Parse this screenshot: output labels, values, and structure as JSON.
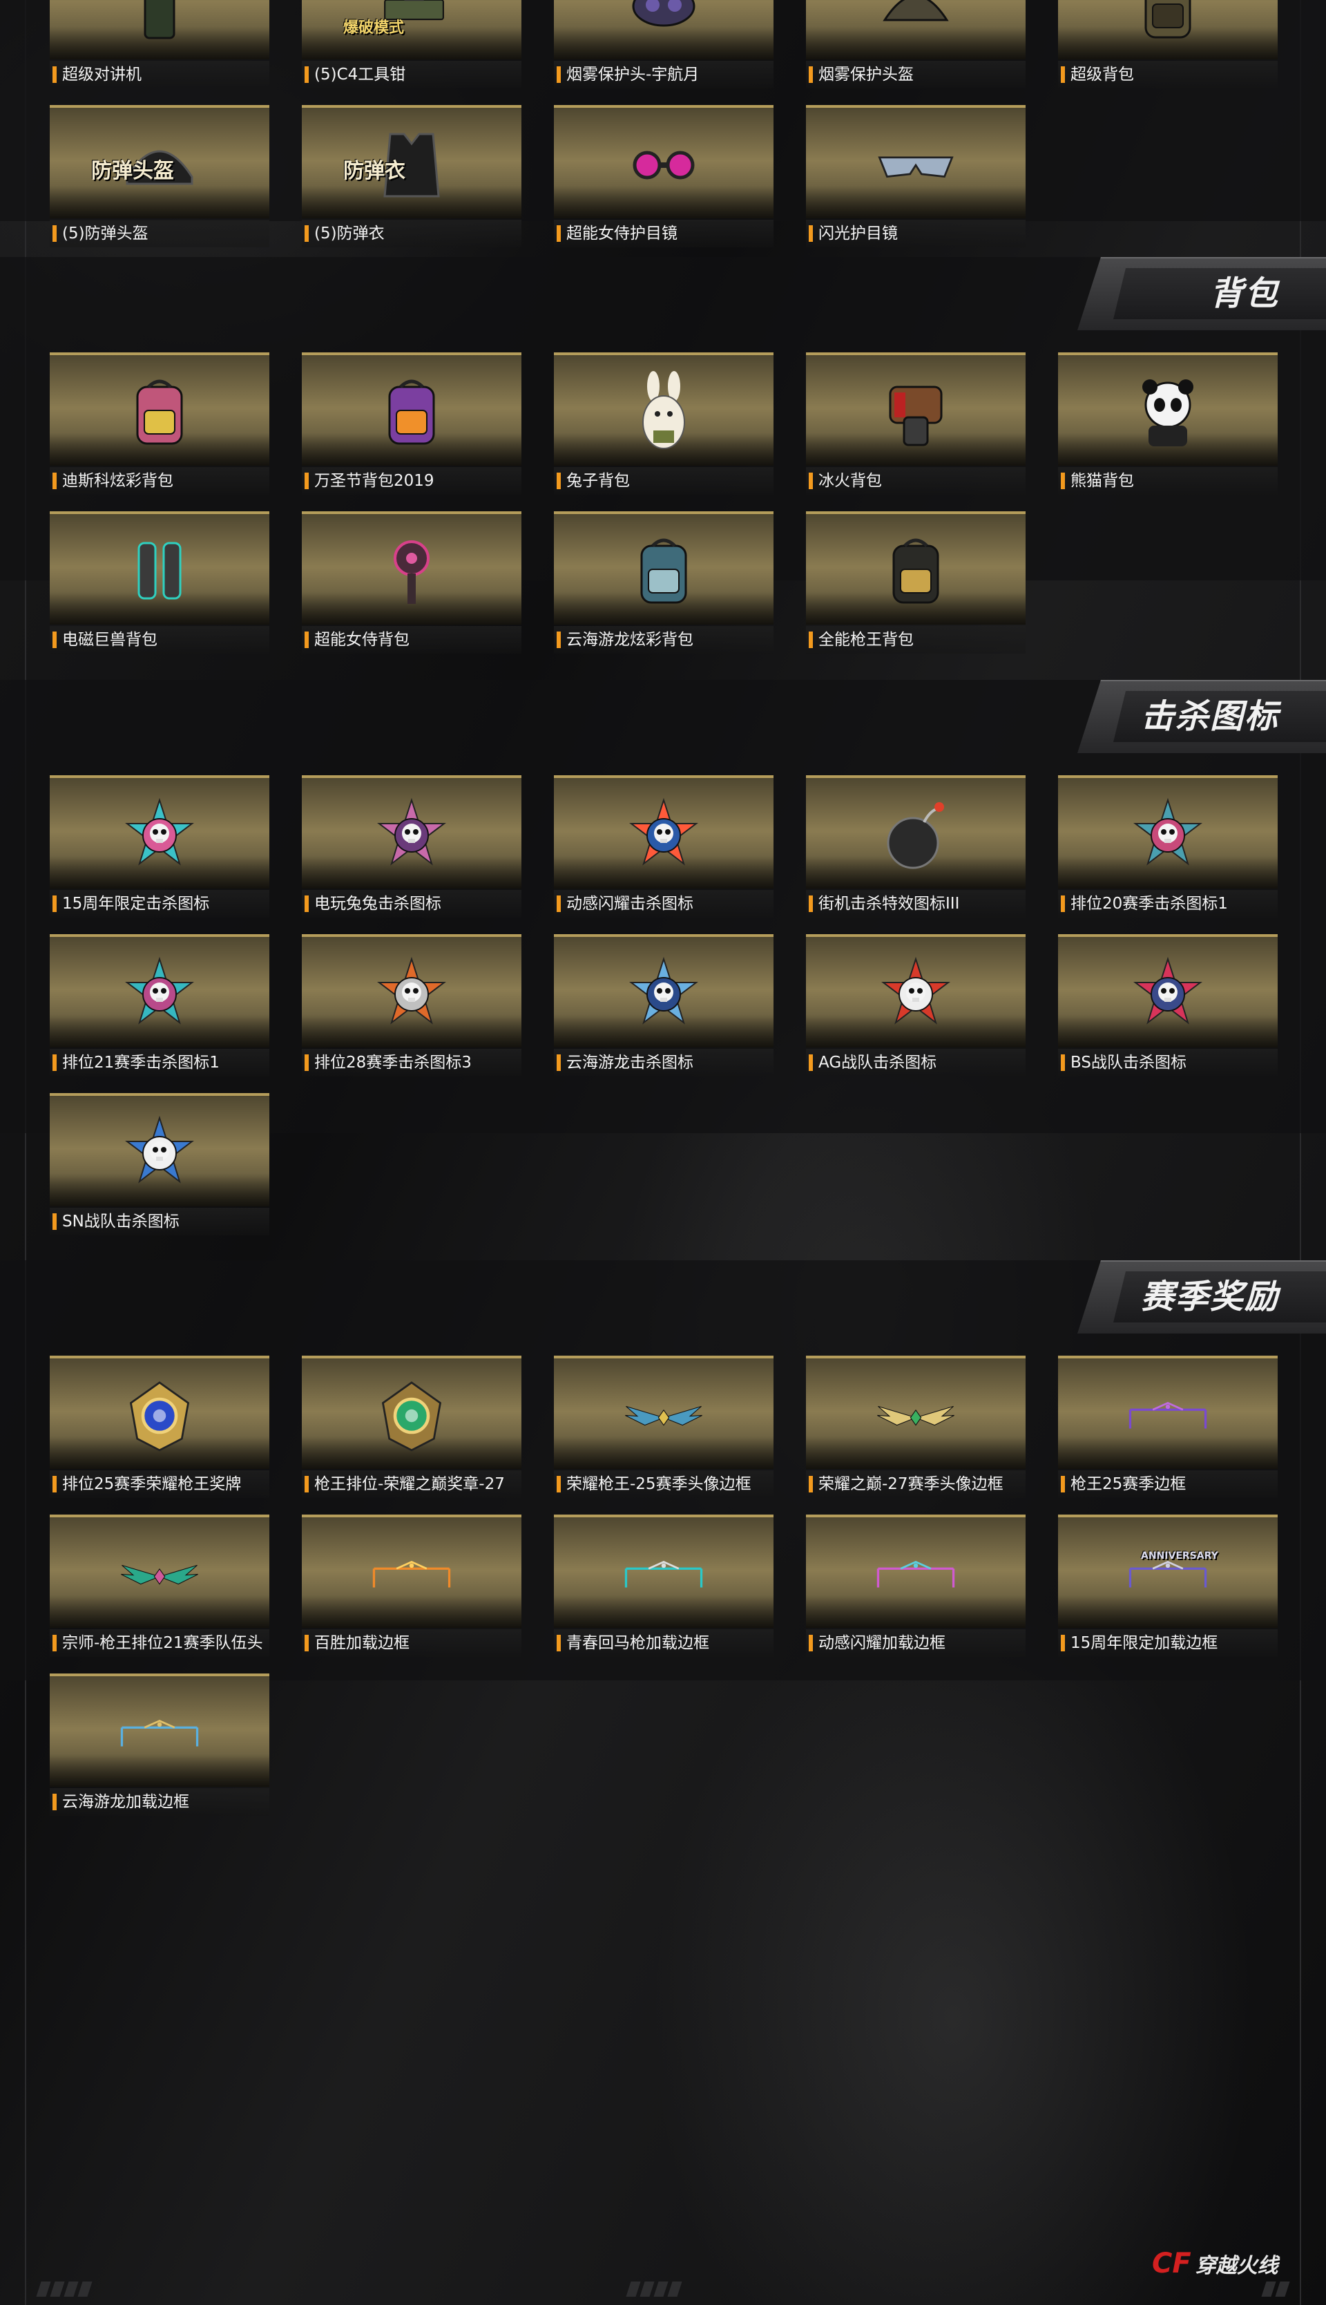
{
  "sections": [
    {
      "id": "top",
      "title": "",
      "items": [
        {
          "label": "超级对讲机",
          "icon": "walkie-talkie-icon"
        },
        {
          "label": "(5)C4工具钳",
          "icon": "toolbox-icon",
          "image_text": "爆破模式"
        },
        {
          "label": "烟雾保护头-宇航月",
          "icon": "smoke-mask-icon"
        },
        {
          "label": "烟雾保护头盔",
          "icon": "smoke-helmet-icon"
        },
        {
          "label": "超级背包",
          "icon": "backpack-icon"
        },
        {
          "label": "(5)防弹头盔",
          "icon": "helmet-icon",
          "image_text": "防弹头盔"
        },
        {
          "label": "(5)防弹衣",
          "icon": "vest-icon",
          "image_text": "防弹衣"
        },
        {
          "label": "超能女侍护目镜",
          "icon": "pink-goggles-icon"
        },
        {
          "label": "闪光护目镜",
          "icon": "sunglasses-icon"
        }
      ]
    },
    {
      "id": "backpacks",
      "title": "背包",
      "items": [
        {
          "label": "迪斯科炫彩背包",
          "icon": "disco-backpack-icon"
        },
        {
          "label": "万圣节背包2019",
          "icon": "halloween-backpack-icon"
        },
        {
          "label": "兔子背包",
          "icon": "rabbit-backpack-icon"
        },
        {
          "label": "冰火背包",
          "icon": "ice-fire-backpack-icon"
        },
        {
          "label": "熊猫背包",
          "icon": "panda-backpack-icon"
        },
        {
          "label": "电磁巨兽背包",
          "icon": "electromagnetic-backpack-icon"
        },
        {
          "label": "超能女侍背包",
          "icon": "maid-backpack-icon"
        },
        {
          "label": "云海游龙炫彩背包",
          "icon": "dragon-backpack-icon"
        },
        {
          "label": "全能枪王背包",
          "icon": "gun-king-backpack-icon"
        }
      ]
    },
    {
      "id": "kill-icons",
      "title": "击杀图标",
      "items": [
        {
          "label": "15周年限定击杀图标",
          "icon": "anniversary-skull-icon"
        },
        {
          "label": "电玩兔兔击杀图标",
          "icon": "bunny-skull-icon"
        },
        {
          "label": "动感闪耀击杀图标",
          "icon": "star-emblem-icon"
        },
        {
          "label": "街机击杀特效图标III",
          "icon": "bomb-icon"
        },
        {
          "label": "排位20赛季击杀图标1",
          "icon": "season20-skull-icon"
        },
        {
          "label": "排位21赛季击杀图标1",
          "icon": "season21-skull-icon"
        },
        {
          "label": "排位28赛季击杀图标3",
          "icon": "season28-skull-icon"
        },
        {
          "label": "云海游龙击杀图标",
          "icon": "dragon-star-icon"
        },
        {
          "label": "AG战队击杀图标",
          "icon": "ag-skull-icon"
        },
        {
          "label": "BS战队击杀图标",
          "icon": "bs-skull-icon"
        },
        {
          "label": "SN战队击杀图标",
          "icon": "sn-skull-icon"
        }
      ]
    },
    {
      "id": "season-rewards",
      "title": "赛季奖励",
      "items": [
        {
          "label": "排位25赛季荣耀枪王奖牌",
          "icon": "blue-medal-icon"
        },
        {
          "label": "枪王排位-荣耀之巅奖章-27",
          "icon": "green-medal-icon"
        },
        {
          "label": "荣耀枪王-25赛季头像边框",
          "icon": "winged-frame-icon"
        },
        {
          "label": "荣耀之巅-27赛季头像边框",
          "icon": "golden-wing-frame-icon"
        },
        {
          "label": "枪王25赛季边框",
          "icon": "purple-frame-icon"
        },
        {
          "label": "宗师-枪王排位21赛季队伍头",
          "icon": "jade-wing-frame-icon"
        },
        {
          "label": "百胜加载边框",
          "icon": "orange-frame-icon"
        },
        {
          "label": "青春回马枪加载边框",
          "icon": "cyan-frame-icon"
        },
        {
          "label": "动感闪耀加载边框",
          "icon": "neon-frame-icon"
        },
        {
          "label": "15周年限定加载边框",
          "icon": "anniversary-frame-icon",
          "image_text": "ANNIVERSARY"
        },
        {
          "label": "云海游龙加载边框",
          "icon": "dragon-frame-icon"
        }
      ]
    }
  ],
  "footer": {
    "logo_mark": "CF",
    "logo_text": "穿越火线"
  },
  "colors": {
    "accent": "#f39a1e",
    "card_gold": "#8a7b51",
    "card_border": "#b59d5b",
    "background": "#111112"
  }
}
